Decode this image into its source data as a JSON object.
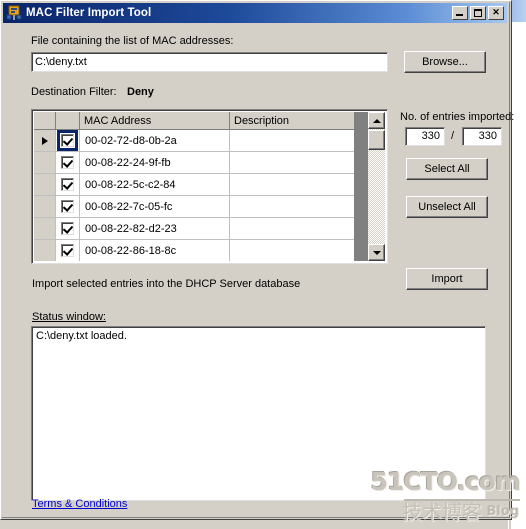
{
  "window": {
    "title": "MAC Filter Import Tool",
    "icon": "mac-filter-app-icon",
    "controls": {
      "minimize": "minimize-button",
      "maximize": "maximize-button",
      "close": "close-button",
      "close_glyph": "✕"
    }
  },
  "file_section": {
    "label": "File containing the list of MAC addresses:",
    "path_value": "C:\\deny.txt",
    "path_placeholder": "",
    "browse_label": "Browse..."
  },
  "destination": {
    "label": "Destination Filter:",
    "value": "Deny"
  },
  "grid": {
    "columns": [
      "",
      "",
      "MAC Address",
      "Description"
    ],
    "header_mac": "MAC Address",
    "header_description": "Description",
    "rows": [
      {
        "current": true,
        "checked": true,
        "mac": "00-02-72-d8-0b-2a",
        "description": ""
      },
      {
        "current": false,
        "checked": true,
        "mac": "00-08-22-24-9f-fb",
        "description": ""
      },
      {
        "current": false,
        "checked": true,
        "mac": "00-08-22-5c-c2-84",
        "description": ""
      },
      {
        "current": false,
        "checked": true,
        "mac": "00-08-22-7c-05-fc",
        "description": ""
      },
      {
        "current": false,
        "checked": true,
        "mac": "00-08-22-82-d2-23",
        "description": ""
      },
      {
        "current": false,
        "checked": true,
        "mac": "00-08-22-86-18-8c",
        "description": ""
      }
    ]
  },
  "entries": {
    "label": "No. of entries imported:",
    "imported": "330",
    "separator": "/",
    "total": "330",
    "select_all_label": "Select All",
    "unselect_all_label": "Unselect All"
  },
  "import": {
    "description": "Import selected entries into the DHCP Server database",
    "button_label": "Import"
  },
  "status": {
    "label": "Status window:",
    "text": "C:\\deny.txt loaded."
  },
  "footer": {
    "terms_label": "Terms & Conditions"
  },
  "watermark": {
    "top": "51CTO.com",
    "chinese": "技术博客",
    "blog": "Blog"
  },
  "colors": {
    "title_gradient_start": "#0a246a",
    "title_gradient_end": "#a6c8f0",
    "dialog_face": "#d4d0c8",
    "link": "#0000cc",
    "selection": "#0a246a"
  }
}
